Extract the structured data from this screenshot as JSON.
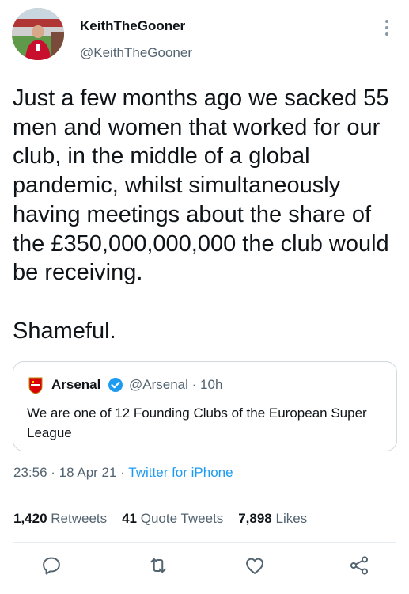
{
  "author": {
    "display_name": "KeithTheGooner",
    "handle": "@KeithTheGooner",
    "avatar_icon": "avatar-photo",
    "more_icon": "more-vertical-icon"
  },
  "tweet": {
    "text": "Just a few months ago we sacked 55 men and women that worked for our club, in the middle of a global pandemic, whilst simultaneously having meetings about the share of the £350,000,000,000 the club would be receiving.\n\nShameful."
  },
  "quoted_tweet": {
    "name": "Arsenal",
    "handle": "@Arsenal",
    "separator": "·",
    "age": "10h",
    "text": "We are one of 12 Founding Clubs of the European Super League",
    "logo_icon": "arsenal-crest-icon",
    "verified_icon": "verified-badge-icon"
  },
  "meta": {
    "time": "23:56",
    "separator": "·",
    "date": "18 Apr 21",
    "source": "Twitter for iPhone"
  },
  "stats": {
    "retweets_count": "1,420",
    "retweets_label": "Retweets",
    "quotes_count": "41",
    "quotes_label": "Quote Tweets",
    "likes_count": "7,898",
    "likes_label": "Likes"
  },
  "actions": [
    "reply-icon",
    "retweet-icon",
    "like-icon",
    "share-icon"
  ],
  "colors": {
    "text": "#0f1419",
    "secondary": "#536471",
    "link": "#1d9bf0",
    "border": "#cfd9de",
    "arsenal_red": "#db0007"
  }
}
